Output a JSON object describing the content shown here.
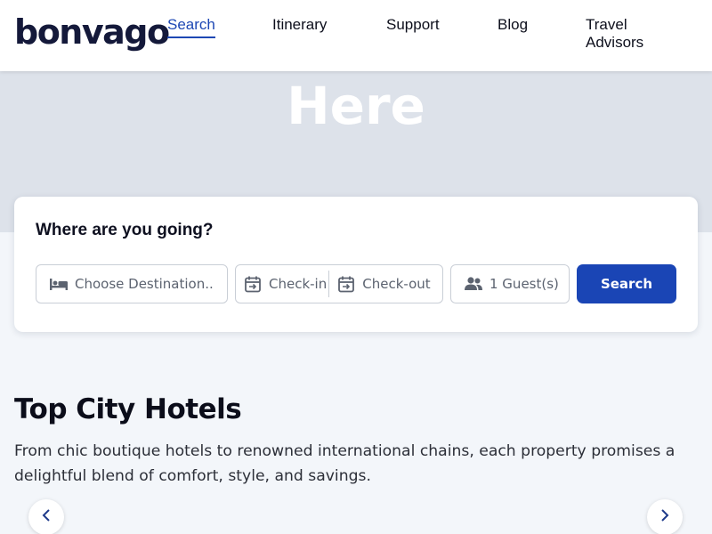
{
  "brand": {
    "logo_text": "bonvago"
  },
  "nav": {
    "items": [
      {
        "label": "Search",
        "active": true
      },
      {
        "label": "Itinerary",
        "active": false
      },
      {
        "label": "Support",
        "active": false
      },
      {
        "label": "Blog",
        "active": false
      },
      {
        "label": "Travel Advisors",
        "active": false
      }
    ]
  },
  "hero": {
    "title": "Here"
  },
  "search": {
    "heading": "Where are you going?",
    "destination_placeholder": "Choose Destination..",
    "checkin_placeholder": "Check-in",
    "checkout_placeholder": "Check-out",
    "guests_value": "1 Guest(s)",
    "button_label": "Search",
    "icons": {
      "destination": "bed-icon",
      "checkin": "calendar-checkin-icon",
      "checkout": "calendar-checkout-icon",
      "guests": "users-icon"
    }
  },
  "section": {
    "title": "Top City Hotels",
    "description": "From chic boutique hotels to renowned international chains, each property promises a delightful blend of comfort, style, and savings."
  },
  "carousel": {
    "prev_icon": "chevron-left-icon",
    "next_icon": "chevron-right-icon"
  },
  "colors": {
    "accent": "#1a45b5",
    "brand_dark": "#14193a",
    "hero_bg": "#dde2ea",
    "page_bg": "#f3f6fa"
  }
}
